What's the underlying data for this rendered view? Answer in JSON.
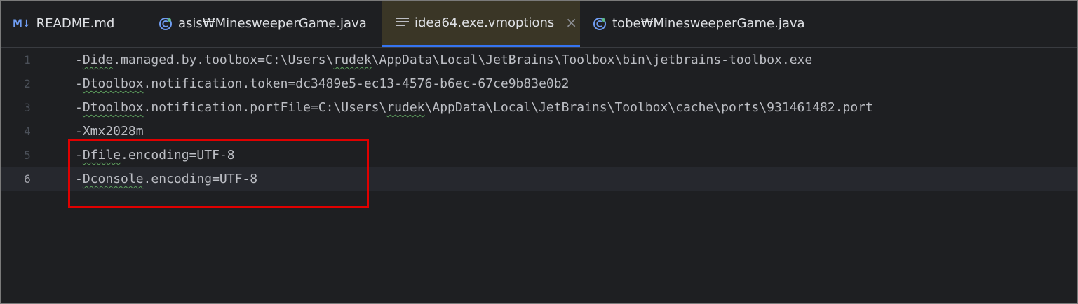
{
  "tabs": [
    {
      "icon": "markdown-icon",
      "icon_text": "M↓",
      "label": "README.md",
      "active": false
    },
    {
      "icon": "java-class-icon",
      "label": "asis₩MinesweeperGame.java",
      "active": false
    },
    {
      "icon": "lines-icon",
      "label": "idea64.exe.vmoptions",
      "active": true,
      "close": "×"
    },
    {
      "icon": "java-class-icon",
      "label": "tobe₩MinesweeperGame.java",
      "active": false
    }
  ],
  "editor": {
    "lines": [
      {
        "num": "1",
        "pre": "-",
        "sq": "Dide",
        "rest": ".managed.by.toolbox=C:\\Users\\",
        "sq2": "rudek",
        "rest2": "\\AppData\\Local\\JetBrains\\Toolbox\\bin\\jetbrains-toolbox.exe"
      },
      {
        "num": "2",
        "pre": "-",
        "sq": "Dtoolbox",
        "rest": ".notification.token=dc3489e5-ec13-4576-b6ec-67ce9b83e0b2",
        "sq2": "",
        "rest2": ""
      },
      {
        "num": "3",
        "pre": "-",
        "sq": "Dtoolbox",
        "rest": ".notification.portFile=C:\\Users\\",
        "sq2": "rudek",
        "rest2": "\\AppData\\Local\\JetBrains\\Toolbox\\cache\\ports\\931461482.port"
      },
      {
        "num": "4",
        "pre": "-Xmx2028m",
        "sq": "",
        "rest": "",
        "sq2": "",
        "rest2": ""
      },
      {
        "num": "5",
        "pre": "-",
        "sq": "Dfile",
        "rest": ".encoding=UTF-8",
        "sq2": "",
        "rest2": ""
      },
      {
        "num": "6",
        "pre": "-",
        "sq": "Dconsole",
        "rest": ".encoding=UTF-8",
        "sq2": "",
        "rest2": ""
      }
    ],
    "current_line": 6
  },
  "colors": {
    "background": "#1e1f22",
    "active_tab_underline": "#3574f0",
    "highlight_box": "#e00000",
    "typo_squiggle": "#5fa35f"
  }
}
